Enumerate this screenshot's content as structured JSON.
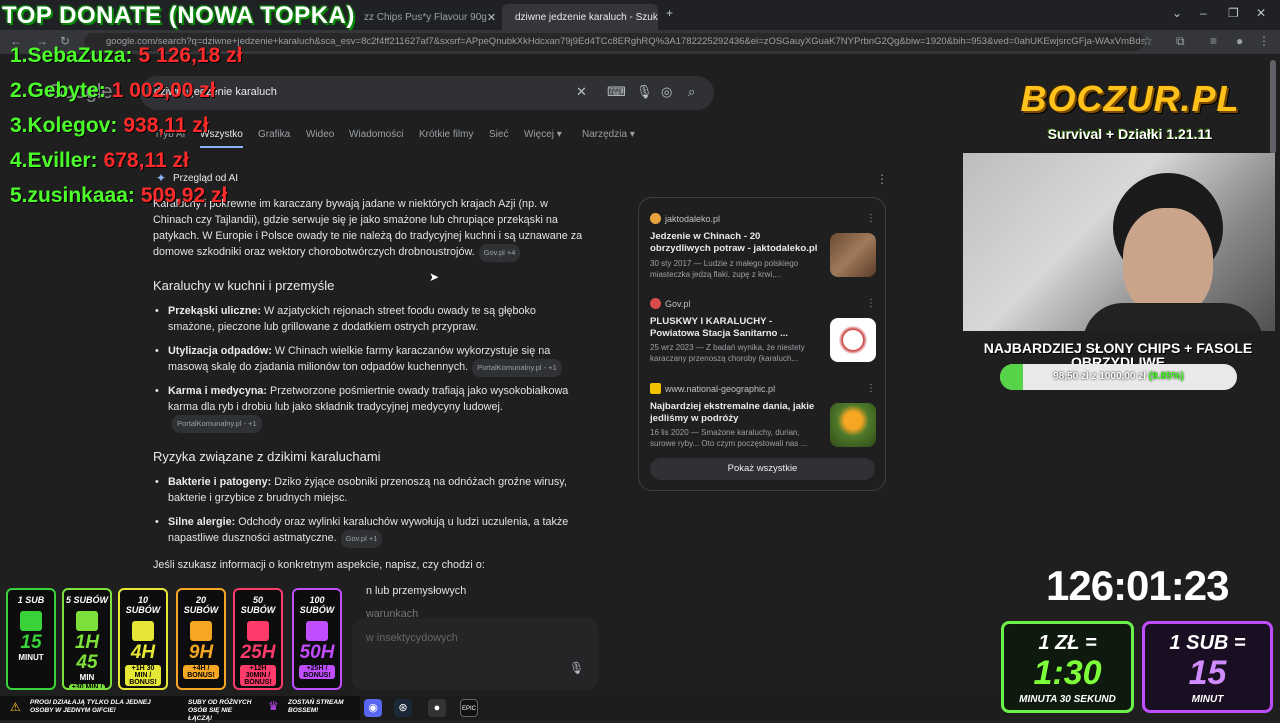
{
  "browser": {
    "tabs": [
      {
        "label": "zz Chips Pus*y Flavour 90g"
      },
      {
        "label": "dziwne jedzenie karaluch - Szukaj"
      }
    ],
    "url": "google.com/search?q=dziwne+jedzenie+karaluch&sca_esv=8c2f4ff211627af7&sxsrf=APpeQnubkXkHdcxan79j9Ed4TCc8ERghRQ%3A1782225292436&ei=zOSGauyXGuaK7NYPrbnG2Qg&biw=1920&bih=953&ved=0ahUKEwjsrcGFja-WAxVmBdsEHa2..."
  },
  "google": {
    "logo": "Google",
    "query": "dziwne jedzenie karaluch",
    "tabs": [
      "Tryb AI",
      "Wszystko",
      "Grafika",
      "Wideo",
      "Wiadomości",
      "Krótkie filmy",
      "Sieć",
      "Więcej",
      "Narzędzia"
    ],
    "ai_label": "Przegląd od AI",
    "intro": "Karaluchy i pokrewne im karaczany bywają jadane w niektórych krajach Azji (np. w Chinach czy Tajlandii), gdzie serwuje się je jako smażone lub chrupiące przekąski na patykach. W Europie i Polsce owady te nie należą do tradycyjnej kuchni i są uznawane za domowe szkodniki oraz wektory chorobotwórczych drobnoustrojów.",
    "intro_cite": "Gov.pl +4",
    "section1_title": "Karaluchy w kuchni i przemyśle",
    "section1_items": [
      {
        "bold": "Przekąski uliczne:",
        "text": " W azjatyckich rejonach street foodu owady te są głęboko smażone, pieczone lub grillowane z dodatkiem ostrych przypraw.",
        "cite": ""
      },
      {
        "bold": "Utylizacja odpadów:",
        "text": " W Chinach wielkie farmy karaczanów wykorzystuje się na masową skalę do zjadania milionów ton odpadów kuchennych.",
        "cite": "PortalKomunalny.pl - +1"
      },
      {
        "bold": "Karma i medycyna:",
        "text": " Przetworzone pośmiertnie owady trafiają jako wysokobiałkowa karma dla ryb i drobiu lub jako składnik tradycyjnej medycyny ludowej.",
        "cite": "PortalKomunalny.pl - +1"
      }
    ],
    "section2_title": "Ryzyka związane z dzikimi karaluchami",
    "section2_items": [
      {
        "bold": "Bakterie i patogeny:",
        "text": " Dziko żyjące osobniki przenoszą na odnóżach groźne wirusy, bakterie i grzybice z brudnych miejsc.",
        "cite": ""
      },
      {
        "bold": "Silne alergie:",
        "text": " Odchody oraz wylinki karaluchów wywołują u ludzi uczulenia, a także napastliwe duszności astmatyczne.",
        "cite": "Gov.pl +1"
      }
    ],
    "closing": "Jeśli szukasz informacji o konkretnym aspekcie, napisz, czy chodzi o:",
    "closing_items": [
      "n lub przemysłowych",
      "warunkach",
      "w insektycydowych"
    ],
    "sources": [
      {
        "domain": "jaktodaleko.pl",
        "title": "Jedzenie w Chinach - 20 obrzydliwych potraw - jaktodaleko.pl",
        "snippet": "30 sty 2017 — Ludzie z małego polskiego miasteczka jedzą flaki, zupę z krwi,..."
      },
      {
        "domain": "Gov.pl",
        "title": "PLUSKWY I KARALUCHY - Powiatowa Stacja Sanitarno ...",
        "snippet": "25 wrz 2023 — Z badań wynika, że niestety karaczany przenoszą choroby (karaluch..."
      },
      {
        "domain": "www.national-geographic.pl",
        "title": "Najbardziej ekstremalne dania, jakie jedliśmy w podróży",
        "snippet": "16 lis 2020 — Smażone karaluchy, durian, surowe ryby... Oto czym poczęstowali nas ..."
      }
    ],
    "show_all": "Pokaż wszystkie"
  },
  "overlay": {
    "top_donate": "TOP DONATE (NOWA TOPKA)",
    "donors": [
      {
        "rank": "1.",
        "name": "SebaZuza:",
        "amount": "5 126,18 zł"
      },
      {
        "rank": "2.",
        "name": "Gebyte:",
        "amount": "1 002,00 zł"
      },
      {
        "rank": "3.",
        "name": "Kolegov:",
        "amount": "938,11 zł"
      },
      {
        "rank": "4.",
        "name": "Eviller:",
        "amount": "678,11 zł"
      },
      {
        "rank": "5.",
        "name": "zusinkaaa:",
        "amount": "509,92 zł"
      }
    ],
    "logo_main": "BOCZUR.PL",
    "logo_sub": "Survival + Działki 1.21.11",
    "goal_title": "NAJBARDZIEJ SŁONY CHIPS + FASOLE OBRZYDLIWE",
    "goal_text": "98,50 zł z 1000,00 zł",
    "goal_pct": "(9.85%)",
    "goal_fraction": 0.0985,
    "timer": "126:01:23",
    "sub_cards": [
      {
        "label": "1 SUB",
        "big": "15",
        "small": "MINUT",
        "bonus": "",
        "color": "#39d23a"
      },
      {
        "label": "5 SUBÓW",
        "big": "1H 45",
        "small": "MIN",
        "bonus": "+30 MIN / BONUS!",
        "color": "#7de03a"
      },
      {
        "label": "10 SUBÓW",
        "big": "4H",
        "small": "",
        "bonus": "+1H 30 MIN / BONUS!",
        "color": "#e6e637"
      },
      {
        "label": "20 SUBÓW",
        "big": "9H",
        "small": "",
        "bonus": "+4H / BONUS!",
        "color": "#f5a623"
      },
      {
        "label": "50 SUBÓW",
        "big": "25H",
        "small": "",
        "bonus": "+12H 30MIN / BONUS!",
        "color": "#ff3b6b"
      },
      {
        "label": "100 SUBÓW",
        "big": "50H",
        "small": "",
        "bonus": "+25H / BONUS!",
        "color": "#c04dff"
      }
    ],
    "rate_money": {
      "top": "1 ZŁ =",
      "value": "1:30",
      "bottom": "MINUTA 30 SEKUND"
    },
    "rate_sub": {
      "top": "1 SUB =",
      "value": "15",
      "bottom": "MINUT"
    },
    "strip_1": "PROGI DZIAŁAJĄ TYLKO DLA JEDNEJ OSOBY W JEDNYM GIFCIE!",
    "strip_2": "SUBY OD RÓŻNYCH OSÓB SIĘ NIE ŁĄCZĄ!",
    "strip_3": "ZOSTAŃ STREAM BOSSEM!"
  }
}
